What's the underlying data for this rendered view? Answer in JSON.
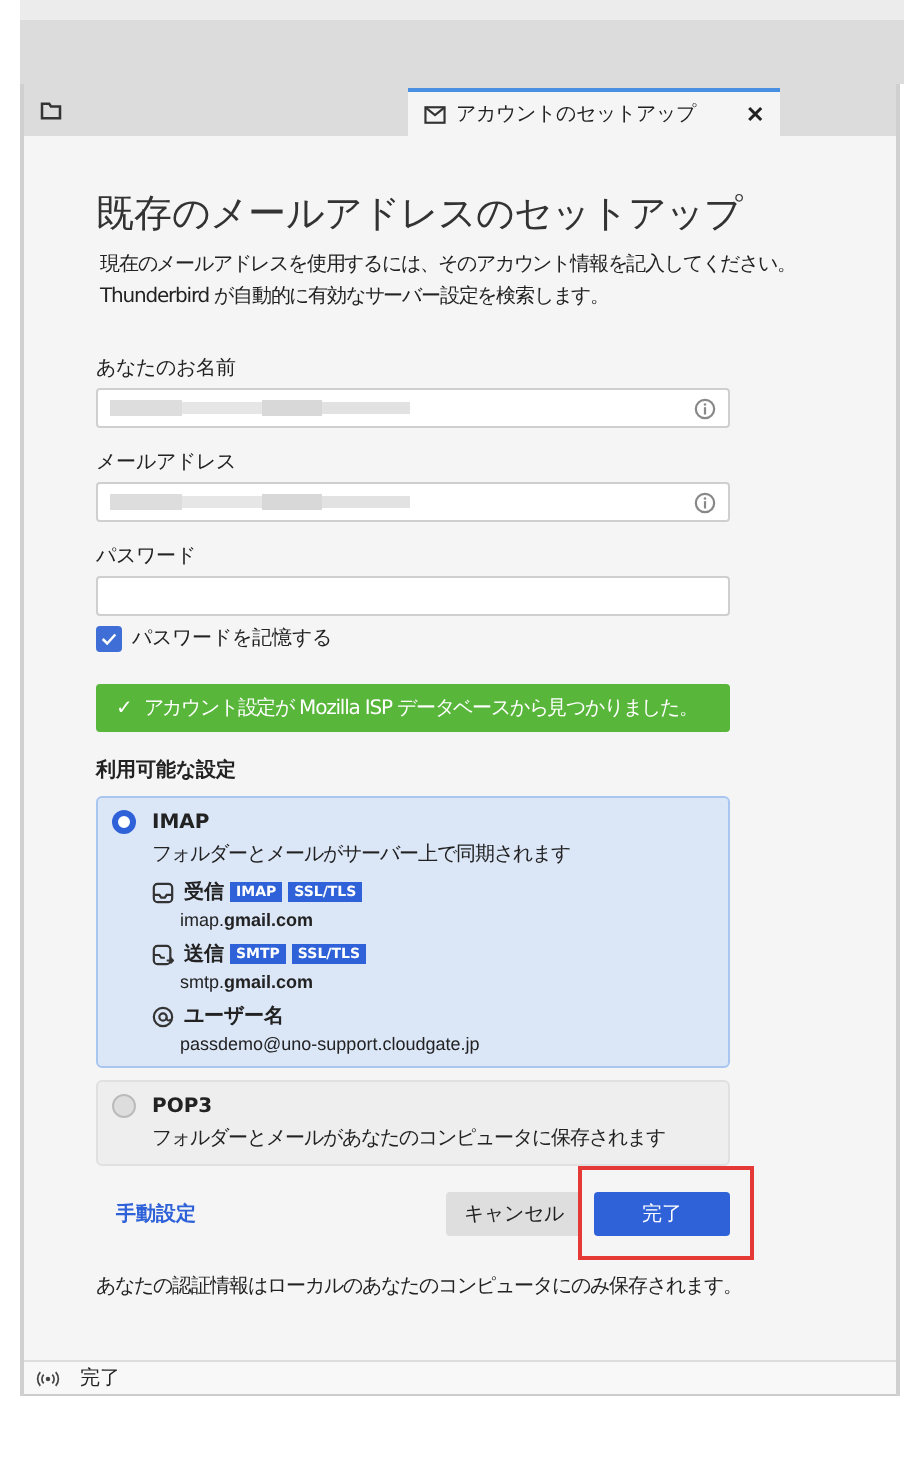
{
  "tab": {
    "title": "アカウントのセットアップ",
    "close": "✕",
    "selected": true
  },
  "heading": "既存のメールアドレスのセットアップ",
  "description": [
    "現在のメールアドレスを使用するには、そのアカウント情報を記入してください。",
    "Thunderbird が自動的に有効なサーバー設定を検索します。"
  ],
  "fields": [
    {
      "label": "あなたのお名前",
      "blurred": true,
      "info": true
    },
    {
      "label": "メールアドレス",
      "blurred": true,
      "info": true
    },
    {
      "label": "パスワード",
      "blurred": false,
      "info": false
    }
  ],
  "remember_password": {
    "label": "パスワードを記憶する",
    "checked": true
  },
  "success_banner": {
    "icon": "✓",
    "text": "アカウント設定が Mozilla ISP データベースから見つかりました。"
  },
  "available_settings": {
    "heading": "利用可能な設定",
    "options": [
      {
        "name": "IMAP",
        "description": "フォルダーとメールがサーバー上で同期されます",
        "selected": true,
        "servers": [
          {
            "kind": "incoming",
            "label": "受信",
            "tags": [
              "IMAP",
              "SSL/TLS"
            ],
            "host_prefix": "imap.",
            "host_domain": "gmail.com"
          },
          {
            "kind": "outgoing",
            "label": "送信",
            "tags": [
              "SMTP",
              "SSL/TLS"
            ],
            "host_prefix": "smtp.",
            "host_domain": "gmail.com"
          },
          {
            "kind": "user",
            "label": "ユーザー名",
            "value": "passdemo@uno-support.cloudgate.jp"
          }
        ]
      },
      {
        "name": "POP3",
        "description": "フォルダーとメールがあなたのコンピュータに保存されます",
        "selected": false
      }
    ]
  },
  "manual_link": "手動設定",
  "buttons": [
    {
      "label": "キャンセル",
      "kind": "secondary",
      "highlighted": false
    },
    {
      "label": "完了",
      "kind": "primary",
      "highlighted": true
    }
  ],
  "footnote": "あなたの認証情報はローカルのあなたのコンピュータにのみ保存されます。",
  "status_bar": {
    "text": "完了"
  }
}
